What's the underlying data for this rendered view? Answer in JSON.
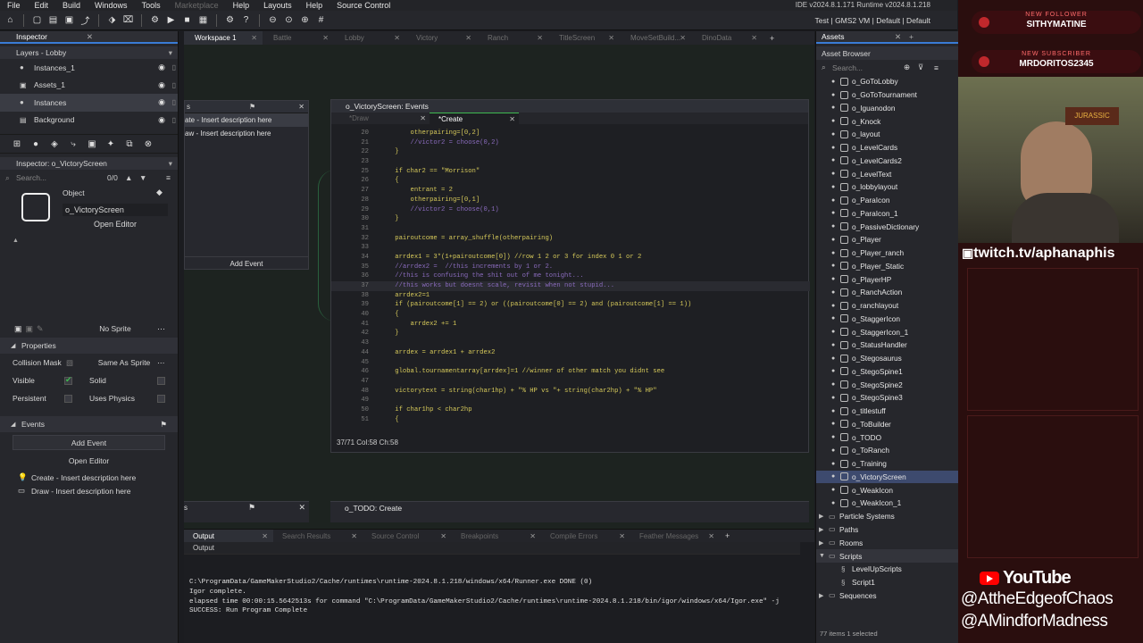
{
  "menu": {
    "items": [
      "File",
      "Edit",
      "Build",
      "Windows",
      "Tools",
      "Marketplace",
      "Help",
      "Layouts",
      "Help",
      "Source Control"
    ],
    "version": "IDE v2024.8.1.171 Runtime v2024.8.1.218"
  },
  "toolbar": {
    "targets": "Test | GMS2 VM | Default | Default"
  },
  "inspector": {
    "tab": "Inspector",
    "layers_title": "Layers - Lobby",
    "layers": [
      "Instances_1",
      "Assets_1",
      "Instances",
      "Background"
    ],
    "object_inspector": "Inspector: o_VictoryScreen",
    "search_placeholder": "Search...",
    "search_count": "0/0",
    "object_label": "Object",
    "object_name": "o_VictoryScreen",
    "open_editor": "Open Editor",
    "no_sprite": "No Sprite",
    "properties": "Properties",
    "collision_mask": "Collision Mask",
    "same_as_sprite": "Same As Sprite",
    "visible": "Visible",
    "solid": "Solid",
    "persistent": "Persistent",
    "uses_physics": "Uses Physics",
    "events": "Events",
    "add_event": "Add Event",
    "events_list": [
      "Create - Insert description here",
      "Draw - Insert description here"
    ]
  },
  "workspace": {
    "tabs": [
      "Workspace 1",
      "Battle",
      "Lobby",
      "Victory",
      "Ranch",
      "TitleScreen",
      "MoveSetBuild...",
      "DinoData"
    ],
    "event_window": {
      "title": "s",
      "rows": [
        "ate - Insert description here",
        "aw - Insert description here"
      ],
      "add_event": "Add Event"
    },
    "code_window": {
      "title": "o_VictoryScreen: Events",
      "tabs": [
        "*Draw",
        "*Create"
      ],
      "status": "37/71 Col:58 Ch:58",
      "lines": [
        {
          "n": "20",
          "t": "        otherpairing=[0,2]"
        },
        {
          "n": "21",
          "t": "        //victor2 = choose(0,2)"
        },
        {
          "n": "22",
          "t": "    }"
        },
        {
          "n": "23",
          "t": ""
        },
        {
          "n": "25",
          "t": "    if char2 == \"Morrison\""
        },
        {
          "n": "26",
          "t": "    {"
        },
        {
          "n": "27",
          "t": "        entrant = 2"
        },
        {
          "n": "28",
          "t": "        otherpairing=[0,1]"
        },
        {
          "n": "29",
          "t": "        //victor2 = choose(0,1)"
        },
        {
          "n": "30",
          "t": "    }"
        },
        {
          "n": "31",
          "t": ""
        },
        {
          "n": "32",
          "t": "    pairoutcome = array_shuffle(otherpairing)"
        },
        {
          "n": "33",
          "t": ""
        },
        {
          "n": "34",
          "t": "    arrdex1 = 3*(1+pairoutcome[0]) //row 1 2 or 3 for index 0 1 or 2"
        },
        {
          "n": "35",
          "t": "    //arrdex2 =  //this increments by 1 or 2."
        },
        {
          "n": "36",
          "t": "    //this is confusing the shit out of me tonight..."
        },
        {
          "n": "37",
          "t": "    //this works but doesnt scale, revisit when not stupid..."
        },
        {
          "n": "38",
          "t": "    arrdex2=1"
        },
        {
          "n": "39",
          "t": "    if (pairoutcome[1] == 2) or ((pairoutcome[0] == 2) and (pairoutcome[1] == 1))"
        },
        {
          "n": "40",
          "t": "    {"
        },
        {
          "n": "41",
          "t": "        arrdex2 += 1"
        },
        {
          "n": "42",
          "t": "    }"
        },
        {
          "n": "43",
          "t": ""
        },
        {
          "n": "44",
          "t": "    arrdex = arrdex1 + arrdex2"
        },
        {
          "n": "45",
          "t": ""
        },
        {
          "n": "46",
          "t": "    global.tournamentarray[arrdex]=1 //winner of other match you didnt see"
        },
        {
          "n": "47",
          "t": ""
        },
        {
          "n": "48",
          "t": "    victorytext = string(char1hp) + \"% HP vs \"+ string(char2hp) + \"% HP\""
        },
        {
          "n": "49",
          "t": ""
        },
        {
          "n": "50",
          "t": "    if char1hp < char2hp"
        },
        {
          "n": "51",
          "t": "    {"
        }
      ]
    },
    "todo_title": "o_TODO: Create"
  },
  "output": {
    "tabs": [
      "Output",
      "Search Results",
      "Source Control",
      "Breakpoints",
      "Compile Errors",
      "Feather Messages"
    ],
    "sub": "Output",
    "log": "C:\\ProgramData/GameMakerStudio2/Cache/runtimes\\runtime-2024.8.1.218/windows/x64/Runner.exe DONE (0)\nIgor complete.\nelapsed time 00:00:15.5642513s for command \"C:\\ProgramData/GameMakerStudio2/Cache/runtimes\\runtime-2024.8.1.218/bin/igor/windows/x64/Igor.exe\" -j\nSUCCESS: Run Program Complete"
  },
  "assets": {
    "tab": "Assets",
    "header": "Asset Browser",
    "search_placeholder": "Search...",
    "objects": [
      "o_GoToLobby",
      "o_GoToTournament",
      "o_Iguanodon",
      "o_Knock",
      "o_layout",
      "o_LevelCards",
      "o_LevelCards2",
      "o_LevelText",
      "o_lobbylayout",
      "o_ParaIcon",
      "o_ParaIcon_1",
      "o_PassiveDictionary",
      "o_Player",
      "o_Player_ranch",
      "o_Player_Static",
      "o_PlayerHP",
      "o_RanchAction",
      "o_ranchlayout",
      "o_StaggerIcon",
      "o_StaggerIcon_1",
      "o_StatusHandler",
      "o_Stegosaurus",
      "o_StegoSpine1",
      "o_StegoSpine2",
      "o_StegoSpine3",
      "o_titlestuff",
      "o_ToBuilder",
      "o_TODO",
      "o_ToRanch",
      "o_Training",
      "o_VictoryScreen",
      "o_WeakIcon",
      "o_WeakIcon_1"
    ],
    "selected": "o_VictoryScreen",
    "folders": [
      "Particle Systems",
      "Paths",
      "Rooms",
      "Scripts"
    ],
    "scripts": [
      "LevelUpScripts",
      "Script1"
    ],
    "last_folder": "Sequences",
    "footer": "77 items  1 selected"
  },
  "stream": {
    "follower_label": "NEW FOLLOWER",
    "follower": "SITHYMATINE",
    "sub_label": "NEW SUBSCRIBER",
    "subscriber": "MRDORITOS2345",
    "twitch": "twitch.tv/aphanaphis",
    "youtube": "YouTube",
    "handle1": "@AttheEdgeofChaos",
    "handle2": "@AMindforMadness"
  }
}
